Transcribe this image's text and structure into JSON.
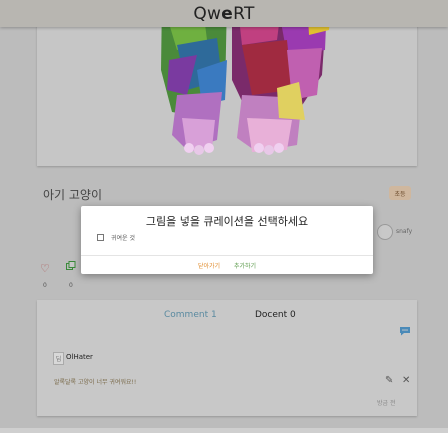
{
  "header": {
    "logo_light": "Qw",
    "logo_bold": "e",
    "logo_tail": "RT"
  },
  "post": {
    "title": "아기 고양이",
    "tag": "초등",
    "author": "snafy",
    "likes": "0",
    "collections": "0"
  },
  "comments": {
    "tab_comment": "Comment 1",
    "tab_docent": "Docent 0",
    "items": [
      {
        "avatar": "딥",
        "author": "OlHater",
        "text": "알록달록 고양이 너무 귀여워요!!",
        "time": "방금 전"
      }
    ]
  },
  "modal": {
    "title": "그림을 넣을 큐레이션을 선택하세요",
    "option_label": "귀여운 것",
    "close_label": "닫아가기",
    "add_label": "추가하기"
  },
  "icons": {
    "like": "heart-icon",
    "collect": "collection-icon",
    "chat": "chat-icon",
    "edit": "pencil-icon",
    "delete": "close-icon"
  },
  "colors": {
    "comment_tab": "#5a8aa0",
    "close_button": "#e08a2a",
    "add_button": "#5a9a4a",
    "tag_badge": "#cfb79e"
  }
}
